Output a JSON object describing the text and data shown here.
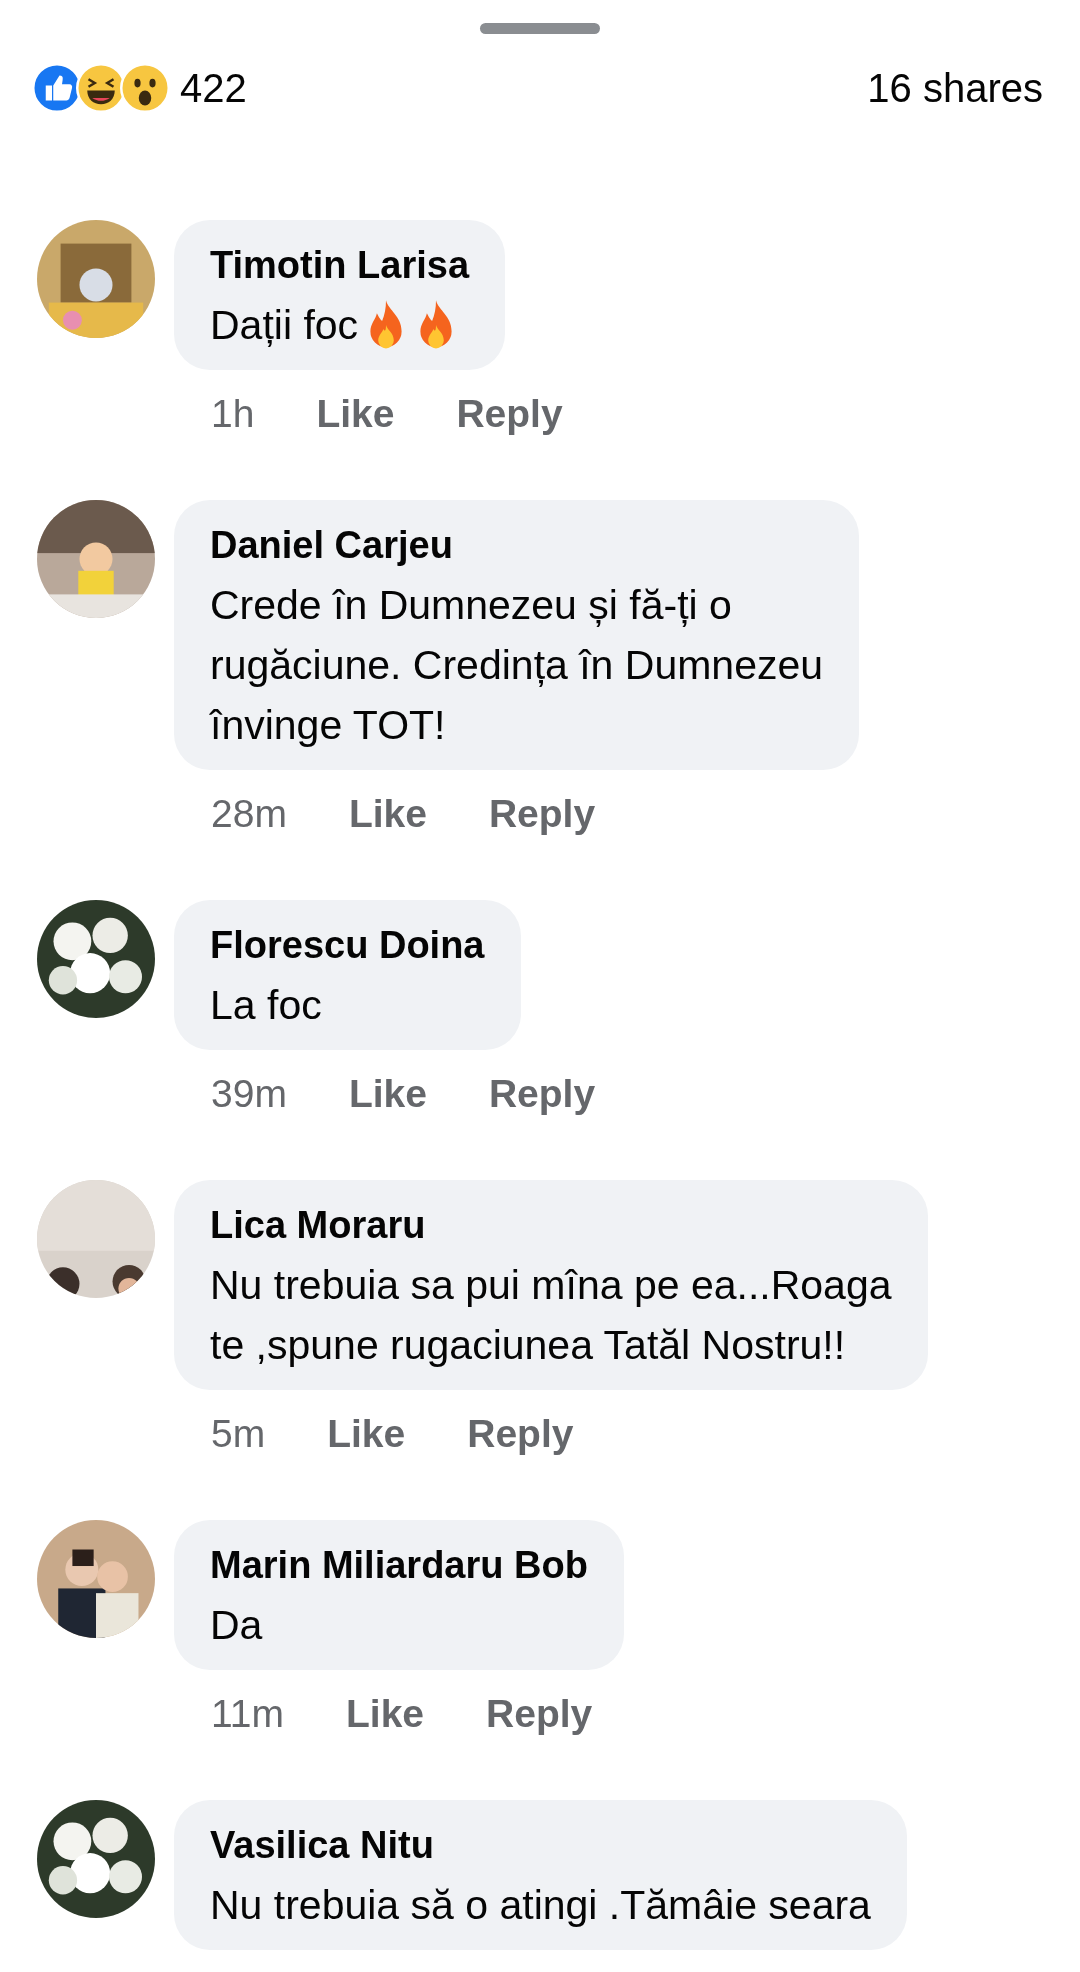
{
  "header": {
    "reactions": [
      {
        "kind": "like"
      },
      {
        "kind": "haha"
      },
      {
        "kind": "wow"
      }
    ],
    "count": "422",
    "shares": "16 shares"
  },
  "comments": [
    {
      "name": "Timotin Larisa",
      "lines": [
        "Dații foc"
      ],
      "emoji": [
        {
          "kind": "fire"
        },
        {
          "kind": "fire"
        }
      ],
      "time": "1h",
      "like": "Like",
      "reply": "Reply"
    },
    {
      "name": "Daniel Carjeu",
      "lines": [
        "Crede în Dumnezeu și fă-ți o",
        "rugăciune. Credința în Dumnezeu",
        "învinge TOT!"
      ],
      "time": "28m",
      "like": "Like",
      "reply": "Reply"
    },
    {
      "name": "Florescu Doina",
      "lines": [
        "La foc"
      ],
      "time": "39m",
      "like": "Like",
      "reply": "Reply"
    },
    {
      "name": "Lica Moraru",
      "lines": [
        "Nu trebuia sa pui mîna pe ea...Roaga",
        "te ,spune rugaciunea Tatăl Nostru!!"
      ],
      "time": "5m",
      "like": "Like",
      "reply": "Reply"
    },
    {
      "name": "Marin Miliardaru Bob",
      "lines": [
        "Da"
      ],
      "time": "11m",
      "like": "Like",
      "reply": "Reply"
    },
    {
      "name": "Vasilica Nitu",
      "lines": [
        "Nu trebuia să o atingi .Tămâie  seara"
      ]
    }
  ]
}
